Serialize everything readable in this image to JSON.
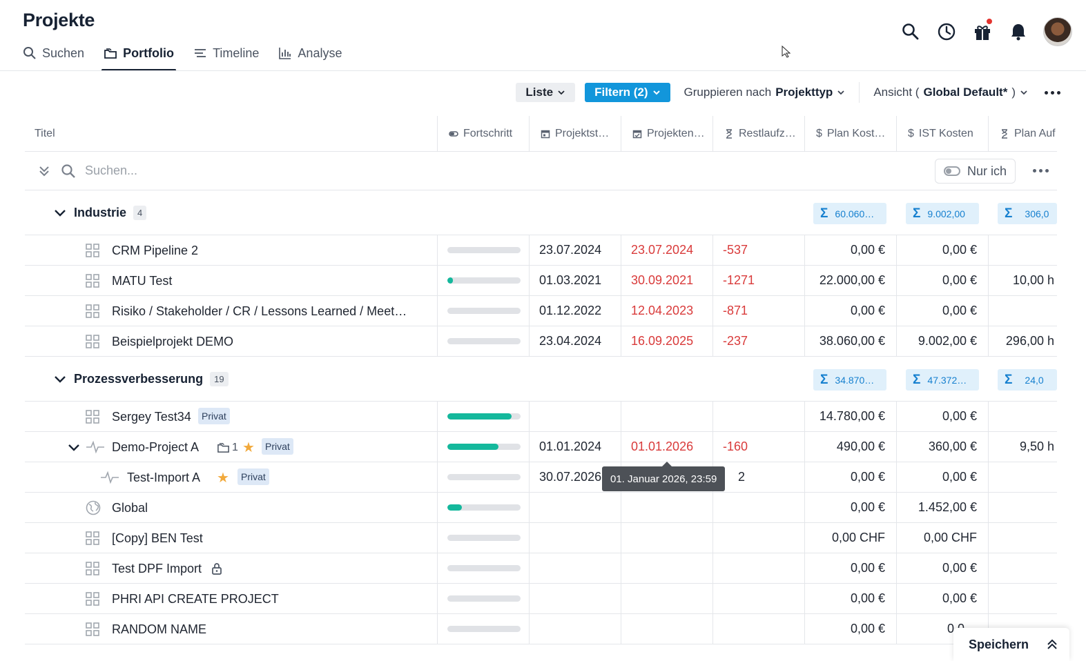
{
  "app": {
    "title": "Projekte"
  },
  "nav": {
    "tabs": [
      {
        "label": "Suchen",
        "icon": "search-icon",
        "active": false
      },
      {
        "label": "Portfolio",
        "icon": "folder-icon",
        "active": true
      },
      {
        "label": "Timeline",
        "icon": "timeline-icon",
        "active": false
      },
      {
        "label": "Analyse",
        "icon": "chart-icon",
        "active": false
      }
    ]
  },
  "toolbar": {
    "liste": "Liste",
    "filter": "Filtern (2)",
    "group_prefix": "Gruppieren nach ",
    "group_value": "Projekttyp",
    "view_prefix": "Ansicht (",
    "view_value": "Global Default*",
    "view_suffix": ")"
  },
  "columns": {
    "title": "Titel",
    "progress": "Fortschritt",
    "start": "Projektst…",
    "end": "Projekten…",
    "rest": "Restlaufz…",
    "plan": "Plan Kost…",
    "ist": "IST Kosten",
    "hours": "Plan Auf"
  },
  "search": {
    "placeholder": "Suchen...",
    "only_me": "Nur ich"
  },
  "groups": [
    {
      "name": "Industrie",
      "count": "4",
      "sum_plan": "60.060…",
      "sum_ist": "9.002,00",
      "sum_hours": "306,0",
      "rows": [
        {
          "title": "CRM Pipeline 2",
          "progress": 0,
          "start": "23.07.2024",
          "end": "23.07.2024",
          "rest": "-537",
          "plan": "0,00 €",
          "ist": "0,00 €",
          "hours": ""
        },
        {
          "title": "MATU Test",
          "progress": 8,
          "start": "01.03.2021",
          "end": "30.09.2021",
          "rest": "-1271",
          "plan": "22.000,00 €",
          "ist": "0,00 €",
          "hours": "10,00 h"
        },
        {
          "title": "Risiko / Stakeholder / CR / Lessons Learned / Meet…",
          "progress": 0,
          "start": "01.12.2022",
          "end": "12.04.2023",
          "rest": "-871",
          "plan": "0,00 €",
          "ist": "0,00 €",
          "hours": ""
        },
        {
          "title": "Beispielprojekt DEMO",
          "progress": 0,
          "start": "23.04.2024",
          "end": "16.09.2025",
          "rest": "-237",
          "plan": "38.060,00 €",
          "ist": "9.002,00 €",
          "hours": "296,00 h"
        }
      ]
    },
    {
      "name": "Prozessverbesserung",
      "count": "19",
      "sum_plan": "34.870…",
      "sum_ist": "47.372…",
      "sum_hours": "24,0",
      "rows": [
        {
          "title": "Sergey Test34",
          "progress": 88,
          "badge": "Privat",
          "start": "",
          "end": "",
          "rest": "",
          "plan": "14.780,00 €",
          "ist": "0,00 €",
          "hours": ""
        },
        {
          "title": "Demo-Project A",
          "progress": 70,
          "subcount": "1",
          "badge": "Privat",
          "start": "01.01.2024",
          "end": "01.01.2026",
          "rest": "-160",
          "plan": "490,00 €",
          "ist": "360,00 €",
          "hours": "9,50 h"
        },
        {
          "title": "Test-Import A",
          "progress": 0,
          "badge": "Privat",
          "start": "30.07.2026",
          "end": "",
          "rest": "2",
          "plan": "0,00 €",
          "ist": "0,00 €",
          "hours": ""
        },
        {
          "title": "Global",
          "progress": 20,
          "start": "",
          "end": "",
          "rest": "",
          "plan": "0,00 €",
          "ist": "1.452,00 €",
          "hours": ""
        },
        {
          "title": "[Copy] BEN Test",
          "progress": 0,
          "start": "",
          "end": "",
          "rest": "",
          "plan": "0,00 CHF",
          "ist": "0,00 CHF",
          "hours": ""
        },
        {
          "title": "Test DPF Import",
          "progress": 0,
          "start": "",
          "end": "",
          "rest": "",
          "plan": "0,00 €",
          "ist": "0,00 €",
          "hours": ""
        },
        {
          "title": "PHRI API CREATE PROJECT",
          "progress": 0,
          "start": "",
          "end": "",
          "rest": "",
          "plan": "0,00 €",
          "ist": "0,00 €",
          "hours": ""
        },
        {
          "title": "RANDOM NAME",
          "progress": 0,
          "start": "",
          "end": "",
          "rest": "",
          "plan": "0,00 €",
          "ist": "0,0…",
          "hours": ""
        }
      ]
    }
  ],
  "tooltip": "01. Januar 2026, 23:59",
  "save_panel": {
    "label": "Speichern"
  },
  "colors": {
    "accent": "#1296db",
    "progress": "#14b89c",
    "overdue": "#d93a3a",
    "sum_bg": "#e0f0fb"
  }
}
